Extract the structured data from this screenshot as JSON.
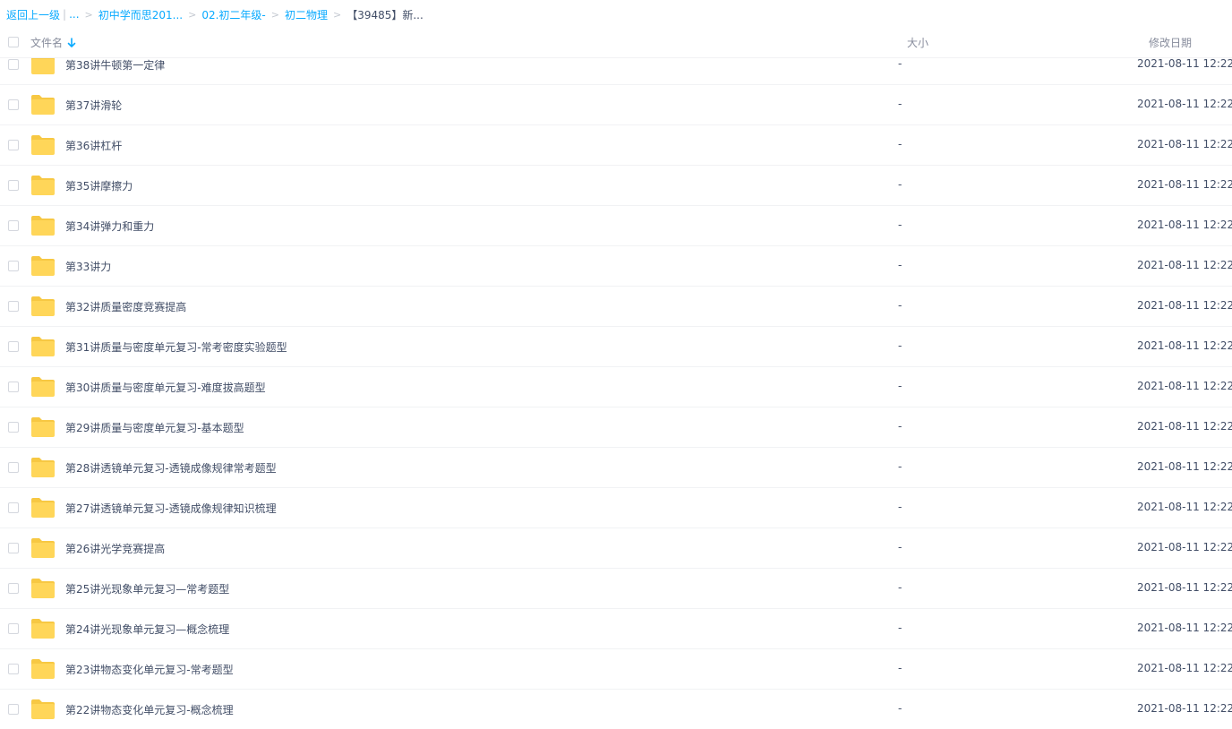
{
  "breadcrumb": {
    "back_label": "返回上一级",
    "pipe": "|",
    "ellipsis": "...",
    "items": [
      "初中学而思201...",
      "02.初二年级-",
      "初二物理"
    ],
    "current": "【39485】新..."
  },
  "header": {
    "name_label": "文件名",
    "size_label": "大小",
    "date_label": "修改日期",
    "sort_icon": "arrow-down-icon"
  },
  "files": [
    {
      "name": "第38讲牛顿第一定律",
      "size": "-",
      "date": "2021-08-11 12:22"
    },
    {
      "name": "第37讲滑轮",
      "size": "-",
      "date": "2021-08-11 12:22"
    },
    {
      "name": "第36讲杠杆",
      "size": "-",
      "date": "2021-08-11 12:22"
    },
    {
      "name": "第35讲摩擦力",
      "size": "-",
      "date": "2021-08-11 12:22"
    },
    {
      "name": "第34讲弹力和重力",
      "size": "-",
      "date": "2021-08-11 12:22"
    },
    {
      "name": "第33讲力",
      "size": "-",
      "date": "2021-08-11 12:22"
    },
    {
      "name": "第32讲质量密度竞赛提高",
      "size": "-",
      "date": "2021-08-11 12:22"
    },
    {
      "name": "第31讲质量与密度单元复习-常考密度实验题型",
      "size": "-",
      "date": "2021-08-11 12:22"
    },
    {
      "name": "第30讲质量与密度单元复习-难度拔高题型",
      "size": "-",
      "date": "2021-08-11 12:22"
    },
    {
      "name": "第29讲质量与密度单元复习-基本题型",
      "size": "-",
      "date": "2021-08-11 12:22"
    },
    {
      "name": "第28讲透镜单元复习-透镜成像规律常考题型",
      "size": "-",
      "date": "2021-08-11 12:22"
    },
    {
      "name": "第27讲透镜单元复习-透镜成像规律知识梳理",
      "size": "-",
      "date": "2021-08-11 12:22"
    },
    {
      "name": "第26讲光学竞赛提高",
      "size": "-",
      "date": "2021-08-11 12:22"
    },
    {
      "name": "第25讲光现象单元复习—常考题型",
      "size": "-",
      "date": "2021-08-11 12:22"
    },
    {
      "name": "第24讲光现象单元复习—概念梳理",
      "size": "-",
      "date": "2021-08-11 12:22"
    },
    {
      "name": "第23讲物态变化单元复习-常考题型",
      "size": "-",
      "date": "2021-08-11 12:22"
    },
    {
      "name": "第22讲物态变化单元复习-概念梳理",
      "size": "-",
      "date": "2021-08-11 12:22"
    }
  ],
  "colors": {
    "link": "#09aaff",
    "folder": "#ffd659",
    "folder_tab": "#f7c843",
    "text": "#424e67",
    "muted": "#878c9c"
  }
}
